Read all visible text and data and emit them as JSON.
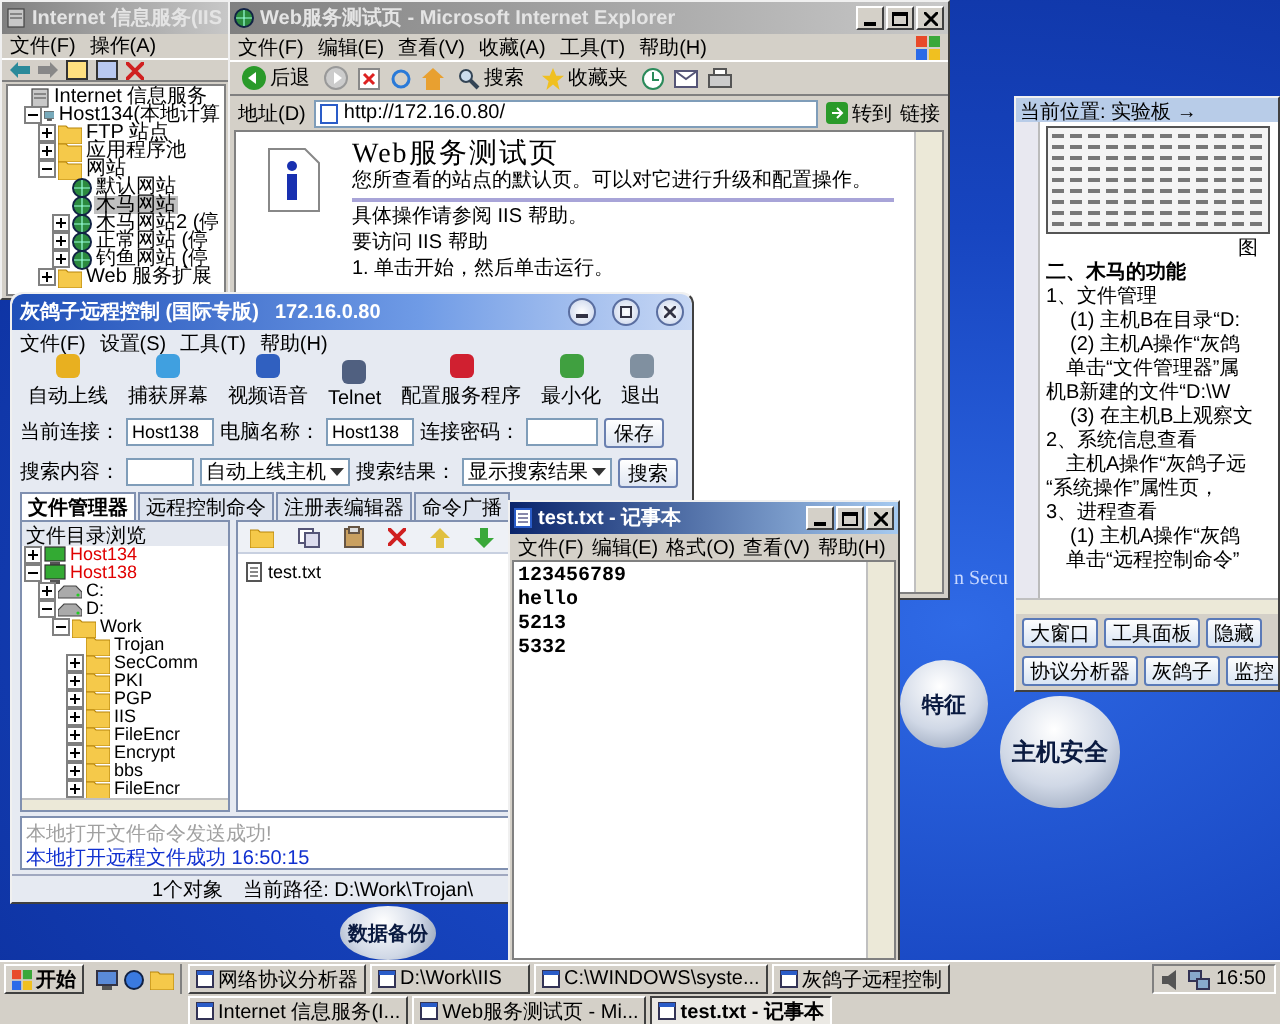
{
  "iis_window": {
    "title": "Internet 信息服务(IIS",
    "active": false,
    "menu": [
      "文件(F)",
      "操作(A)"
    ],
    "tree": [
      {
        "label": "Internet 信息服务",
        "kind": "root",
        "selected": false,
        "children": [
          {
            "label": "Host134(本地计算",
            "kind": "computer",
            "expanded": true,
            "selected": false,
            "children": [
              {
                "label": "FTP 站点",
                "kind": "folder",
                "expanded": false,
                "selected": false
              },
              {
                "label": "应用程序池",
                "kind": "folder",
                "expanded": false,
                "selected": false
              },
              {
                "label": "网站",
                "kind": "folder",
                "expanded": true,
                "selected": false,
                "children": [
                  {
                    "label": "默认网站",
                    "kind": "site",
                    "selected": false
                  },
                  {
                    "label": "木马网站",
                    "kind": "site",
                    "selected": true
                  },
                  {
                    "label": "木马网站2 (停",
                    "kind": "site",
                    "expanded": false,
                    "selected": false
                  },
                  {
                    "label": "正常网站 (停",
                    "kind": "site",
                    "expanded": false,
                    "selected": false
                  },
                  {
                    "label": "钓鱼网站 (停",
                    "kind": "site",
                    "expanded": false,
                    "selected": false
                  }
                ]
              },
              {
                "label": "Web 服务扩展",
                "kind": "folder",
                "expanded": false,
                "selected": false
              }
            ]
          }
        ]
      }
    ]
  },
  "ie_window": {
    "title": "Web服务测试页 - Microsoft Internet Explorer",
    "active": false,
    "menu": [
      "文件(F)",
      "编辑(E)",
      "查看(V)",
      "收藏(A)",
      "工具(T)",
      "帮助(H)"
    ],
    "toolbar": {
      "back": "后退",
      "search": "搜索",
      "favorites": "收藏夹"
    },
    "address_label": "地址(D)",
    "url": "http://172.16.0.80/",
    "go_button": "转到",
    "links": "链接",
    "page": {
      "heading": "Web服务测试页",
      "intro": "您所查看的站点的默认页。可以对它进行升级和配置操作。",
      "lines": [
        "具体操作请参阅 IIS 帮助。",
        "要访问 IIS 帮助",
        "1.  单击开始，然后单击运行。"
      ]
    }
  },
  "doc_window": {
    "breadcrumb": "当前位置: 实验板 →",
    "figure_caption": "图",
    "heading": "二、木马的功能",
    "paragraphs": [
      {
        "kind": "section",
        "text": "1、文件管理"
      },
      {
        "kind": "step",
        "text": "(1) 主机B在目录“D:"
      },
      {
        "kind": "step",
        "text": "(2) 主机A操作“灰鸽"
      },
      {
        "kind": "body",
        "text": "单击“文件管理器”属"
      },
      {
        "kind": "plain",
        "text": "机B新建的文件“D:\\W"
      },
      {
        "kind": "step",
        "text": "(3) 在主机B上观察文"
      },
      {
        "kind": "section",
        "text": "2、系统信息查看"
      },
      {
        "kind": "body",
        "text": "主机A操作“灰鸽子远"
      },
      {
        "kind": "plain",
        "text": "“系统操作”属性页，"
      },
      {
        "kind": "section",
        "text": "3、进程查看"
      },
      {
        "kind": "step",
        "text": "(1) 主机A操作“灰鸽"
      },
      {
        "kind": "body",
        "text": "单击“远程控制命令”"
      }
    ],
    "button_rows": [
      [
        "大窗口",
        "工具面板",
        "隐藏"
      ],
      [
        "协议分析器",
        "灰鸽子",
        "监控"
      ]
    ]
  },
  "trojan_window": {
    "title": "灰鸽子远程控制 (国际专版)",
    "address": "172.16.0.80",
    "menu": [
      "文件(F)",
      "设置(S)",
      "工具(T)",
      "帮助(H)"
    ],
    "tools": [
      "自动上线",
      "捕获屏幕",
      "视频语音",
      "Telnet",
      "配置服务程序",
      "最小化",
      "退出"
    ],
    "connection_row": {
      "current_label": "当前连接：",
      "current_value": "Host138",
      "computer_label": "电脑名称：",
      "computer_value": "Host138",
      "password_label": "连接密码：",
      "save_button": "保存"
    },
    "search_row": {
      "search_label": "搜索内容：",
      "host_select": "自动上线主机",
      "result_label": "搜索结果：",
      "result_select": "显示搜索结果",
      "search_button": "搜索"
    },
    "tabs": [
      {
        "label": "文件管理器",
        "selected": true
      },
      {
        "label": "远程控制命令",
        "selected": false
      },
      {
        "label": "注册表编辑器",
        "selected": false
      },
      {
        "label": "命令广播",
        "selected": false
      }
    ],
    "tree_header": "文件目录浏览",
    "tree": [
      {
        "label": "Host134",
        "kind": "host",
        "expanded": false
      },
      {
        "label": "Host138",
        "kind": "host",
        "expanded": true,
        "children": [
          {
            "label": "C:",
            "kind": "drive",
            "expanded": false
          },
          {
            "label": "D:",
            "kind": "drive",
            "expanded": true,
            "children": [
              {
                "label": "Work",
                "kind": "folder",
                "expanded": true,
                "children": [
                  {
                    "label": "Trojan",
                    "kind": "folder"
                  },
                  {
                    "label": "SecComm",
                    "kind": "folder",
                    "expanded": false
                  },
                  {
                    "label": "PKI",
                    "kind": "folder",
                    "expanded": false
                  },
                  {
                    "label": "PGP",
                    "kind": "folder",
                    "expanded": false
                  },
                  {
                    "label": "IIS",
                    "kind": "folder",
                    "expanded": false
                  },
                  {
                    "label": "FileEncr",
                    "kind": "folder",
                    "expanded": false
                  },
                  {
                    "label": "Encrypt",
                    "kind": "folder",
                    "expanded": false
                  },
                  {
                    "label": "bbs",
                    "kind": "folder",
                    "expanded": false
                  },
                  {
                    "label": "FileEncr",
                    "kind": "folder",
                    "expanded": false
                  }
                ]
              }
            ]
          }
        ]
      }
    ],
    "files": [
      "test.txt"
    ],
    "log": [
      {
        "kind": "info",
        "text": "本地打开文件命令发送成功!"
      },
      {
        "kind": "success",
        "text": "本地打开远程文件成功 16:50:15"
      }
    ],
    "status": {
      "count": "1个对象",
      "path": "当前路径: D:\\Work\\Trojan\\"
    }
  },
  "notepad_window": {
    "title": "test.txt - 记事本",
    "active": true,
    "menu": [
      "文件(F)",
      "编辑(E)",
      "格式(O)",
      "查看(V)",
      "帮助(H)"
    ],
    "lines": [
      "123456789",
      "hello",
      "5213",
      "5332"
    ]
  },
  "desktop": {
    "banner": "n Secu",
    "spheres": [
      "特征",
      "主机安全",
      "数据备份"
    ]
  },
  "taskbar": {
    "start": "开始",
    "tasks": [
      {
        "label": "网络协议分析器",
        "selected": false
      },
      {
        "label": "D:\\Work\\IIS",
        "selected": false
      },
      {
        "label": "C:\\WINDOWS\\syste...",
        "selected": false
      },
      {
        "label": "灰鸽子远程控制",
        "selected": false
      },
      {
        "label": "Internet 信息服务(I...",
        "selected": false
      },
      {
        "label": "Web服务测试页 - Mi...",
        "selected": false
      },
      {
        "label": "test.txt - 记事本",
        "selected": true
      }
    ],
    "clock": "16:50"
  }
}
